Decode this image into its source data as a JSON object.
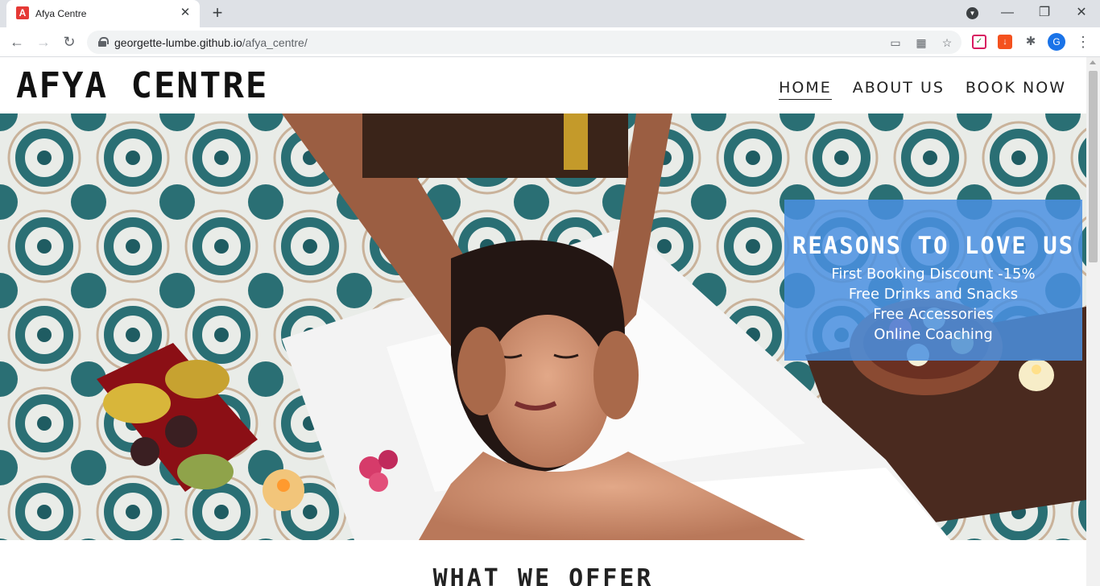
{
  "browser": {
    "tab_title": "Afya Centre",
    "tab_favicon_letter": "A",
    "url_host": "georgette-lumbe.github.io",
    "url_path": "/afya_centre/",
    "profile_initial": "G"
  },
  "site": {
    "logo": "AFYA CENTRE",
    "nav": {
      "home": "HOME",
      "about": "ABOUT US",
      "book": "BOOK NOW"
    },
    "promo": {
      "title": "REASONS TO LOVE US",
      "items": [
        "First Booking Discount -15%",
        "Free Drinks and Snacks",
        "Free Accessories",
        "Online Coaching"
      ]
    },
    "section_title": "WHAT WE OFFER"
  },
  "colors": {
    "promo_bg": "#4a90e2",
    "tab_bar": "#dee1e6"
  }
}
